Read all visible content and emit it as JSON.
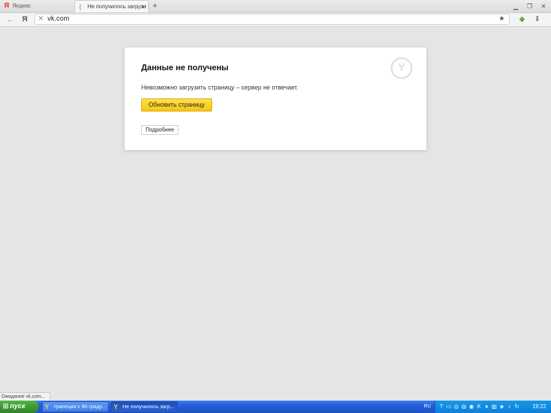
{
  "browser": {
    "tabs": [
      {
        "label": "Яндекс",
        "active": false,
        "icon": "yandex-icon"
      },
      {
        "label": "Не получилось загрузи",
        "active": true,
        "icon": "loading-icon"
      }
    ],
    "new_tab_label": "+",
    "address_bar": {
      "url": "vk.com",
      "ya_label": "Я"
    }
  },
  "error_page": {
    "title": "Данные не получены",
    "message": "Невозможно загрузить страницу – сервер не отвечает.",
    "reload_label": "Обновить страницу",
    "details_label": "Подробнее",
    "accent_color": "#f8c510"
  },
  "status_line": "Ожидание vk.com...",
  "taskbar": {
    "start_label": "пуск",
    "tasks": [
      {
        "label": "трапеция с 90 граду...",
        "active": false
      },
      {
        "label": "Не получилось загр...",
        "active": true
      }
    ],
    "language": "RU",
    "clock": "19:22"
  }
}
